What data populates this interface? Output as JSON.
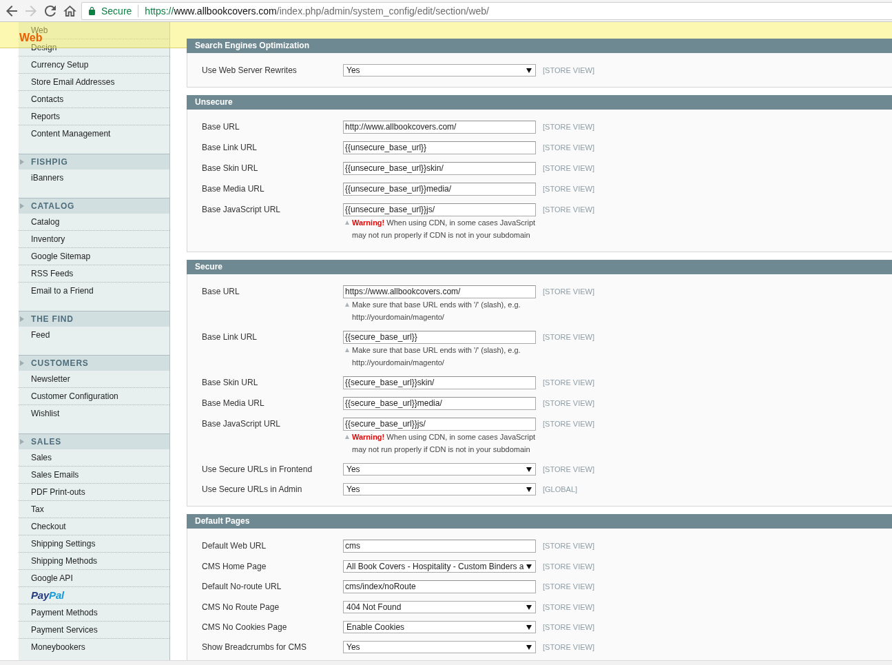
{
  "browser": {
    "nav_buttons": [
      {
        "kind": "back",
        "disabled": false
      },
      {
        "kind": "forward",
        "disabled": true
      },
      {
        "kind": "reload",
        "disabled": false
      },
      {
        "kind": "home",
        "disabled": false
      }
    ],
    "address_bar": {
      "security_label": "Secure",
      "scheme": "https://",
      "host": "www.allbookcovers.com",
      "path": "/index.php/admin/system_config/edit/section/web/"
    }
  },
  "floating_header": {
    "title": "Web"
  },
  "sidebar": {
    "groups": [
      {
        "items": [
          {
            "kind": "link",
            "label": "Web"
          },
          {
            "kind": "link",
            "label": "Design"
          },
          {
            "kind": "link",
            "label": "Currency Setup"
          },
          {
            "kind": "link",
            "label": "Store Email Addresses"
          },
          {
            "kind": "link",
            "label": "Contacts"
          },
          {
            "kind": "link",
            "label": "Reports"
          },
          {
            "kind": "link",
            "label": "Content Management"
          }
        ]
      },
      {
        "title": "FISHPIG",
        "items": [
          {
            "kind": "link",
            "label": "iBanners"
          }
        ]
      },
      {
        "title": "CATALOG",
        "items": [
          {
            "kind": "link",
            "label": "Catalog"
          },
          {
            "kind": "link",
            "label": "Inventory"
          },
          {
            "kind": "link",
            "label": "Google Sitemap"
          },
          {
            "kind": "link",
            "label": "RSS Feeds"
          },
          {
            "kind": "link",
            "label": "Email to a Friend"
          }
        ]
      },
      {
        "title": "THE FIND",
        "items": [
          {
            "kind": "link",
            "label": "Feed"
          }
        ]
      },
      {
        "title": "CUSTOMERS",
        "items": [
          {
            "kind": "link",
            "label": "Newsletter"
          },
          {
            "kind": "link",
            "label": "Customer Configuration"
          },
          {
            "kind": "link",
            "label": "Wishlist"
          }
        ]
      },
      {
        "title": "SALES",
        "items": [
          {
            "kind": "link",
            "label": "Sales"
          },
          {
            "kind": "link",
            "label": "Sales Emails"
          },
          {
            "kind": "link",
            "label": "PDF Print-outs"
          },
          {
            "kind": "link",
            "label": "Tax"
          },
          {
            "kind": "link",
            "label": "Checkout"
          },
          {
            "kind": "link",
            "label": "Shipping Settings"
          },
          {
            "kind": "link",
            "label": "Shipping Methods"
          },
          {
            "kind": "link",
            "label": "Google API"
          },
          {
            "kind": "logo",
            "parts": [
              "Pay",
              "Pal"
            ]
          },
          {
            "kind": "link",
            "label": "Payment Methods"
          },
          {
            "kind": "link",
            "label": "Payment Services"
          },
          {
            "kind": "link",
            "label": "Moneybookers"
          }
        ]
      }
    ]
  },
  "sections": [
    {
      "title": "Search Engines Optimization",
      "rows": [
        {
          "label": "Use Web Server Rewrites",
          "kind": "select",
          "value": "Yes",
          "scope": "[STORE VIEW]"
        }
      ]
    },
    {
      "title": "Unsecure",
      "rows": [
        {
          "label": "Base URL",
          "kind": "text",
          "value": "http://www.allbookcovers.com/",
          "scope": "[STORE VIEW]"
        },
        {
          "label": "Base Link URL",
          "kind": "text",
          "value": "{{unsecure_base_url}}",
          "scope": "[STORE VIEW]"
        },
        {
          "label": "Base Skin URL",
          "kind": "text",
          "value": "{{unsecure_base_url}}skin/",
          "scope": "[STORE VIEW]"
        },
        {
          "label": "Base Media URL",
          "kind": "text",
          "value": "{{unsecure_base_url}}media/",
          "scope": "[STORE VIEW]"
        },
        {
          "label": "Base JavaScript URL",
          "kind": "text",
          "value": "{{unsecure_base_url}}js/",
          "scope": "[STORE VIEW]",
          "note": {
            "kind": "warning",
            "text": "**Warning!** When using CDN, in some cases JavaScript may not run properly if CDN is not in your subdomain"
          }
        }
      ]
    },
    {
      "title": "Secure",
      "rows": [
        {
          "label": "Base URL",
          "kind": "text",
          "value": "https://www.allbookcovers.com/",
          "scope": "[STORE VIEW]",
          "note": {
            "kind": "hint",
            "text": "Make sure that base URL ends with '/' (slash), e.g. http://yourdomain/magento/"
          }
        },
        {
          "label": "Base Link URL",
          "kind": "text",
          "value": "{{secure_base_url}}",
          "scope": "[STORE VIEW]",
          "note": {
            "kind": "hint",
            "text": "Make sure that base URL ends with '/' (slash), e.g. http://yourdomain/magento/"
          }
        },
        {
          "label": "Base Skin URL",
          "kind": "text",
          "value": "{{secure_base_url}}skin/",
          "scope": "[STORE VIEW]"
        },
        {
          "label": "Base Media URL",
          "kind": "text",
          "value": "{{secure_base_url}}media/",
          "scope": "[STORE VIEW]"
        },
        {
          "label": "Base JavaScript URL",
          "kind": "text",
          "value": "{{secure_base_url}}js/",
          "scope": "[STORE VIEW]",
          "note": {
            "kind": "warning",
            "text": "**Warning!** When using CDN, in some cases JavaScript may not run properly if CDN is not in your subdomain"
          }
        },
        {
          "label": "Use Secure URLs in Frontend",
          "kind": "select",
          "value": "Yes",
          "scope": "[STORE VIEW]"
        },
        {
          "label": "Use Secure URLs in Admin",
          "kind": "select",
          "value": "Yes",
          "scope": "[GLOBAL]"
        }
      ]
    },
    {
      "title": "Default Pages",
      "rows": [
        {
          "label": "Default Web URL",
          "kind": "text",
          "value": "cms",
          "scope": "[STORE VIEW]"
        },
        {
          "label": "CMS Home Page",
          "kind": "select",
          "value": "All Book Covers - Hospitality - Custom Binders a",
          "scope": "[STORE VIEW]"
        },
        {
          "label": "Default No-route URL",
          "kind": "text",
          "value": "cms/index/noRoute",
          "scope": "[STORE VIEW]"
        },
        {
          "label": "CMS No Route Page",
          "kind": "select",
          "value": "404 Not Found",
          "scope": "[STORE VIEW]"
        },
        {
          "label": "CMS No Cookies Page",
          "kind": "select",
          "value": "Enable Cookies",
          "scope": "[STORE VIEW]"
        },
        {
          "label": "Show Breadcrumbs for CMS",
          "kind": "select",
          "value": "Yes",
          "scope": "[STORE VIEW]"
        }
      ]
    }
  ]
}
